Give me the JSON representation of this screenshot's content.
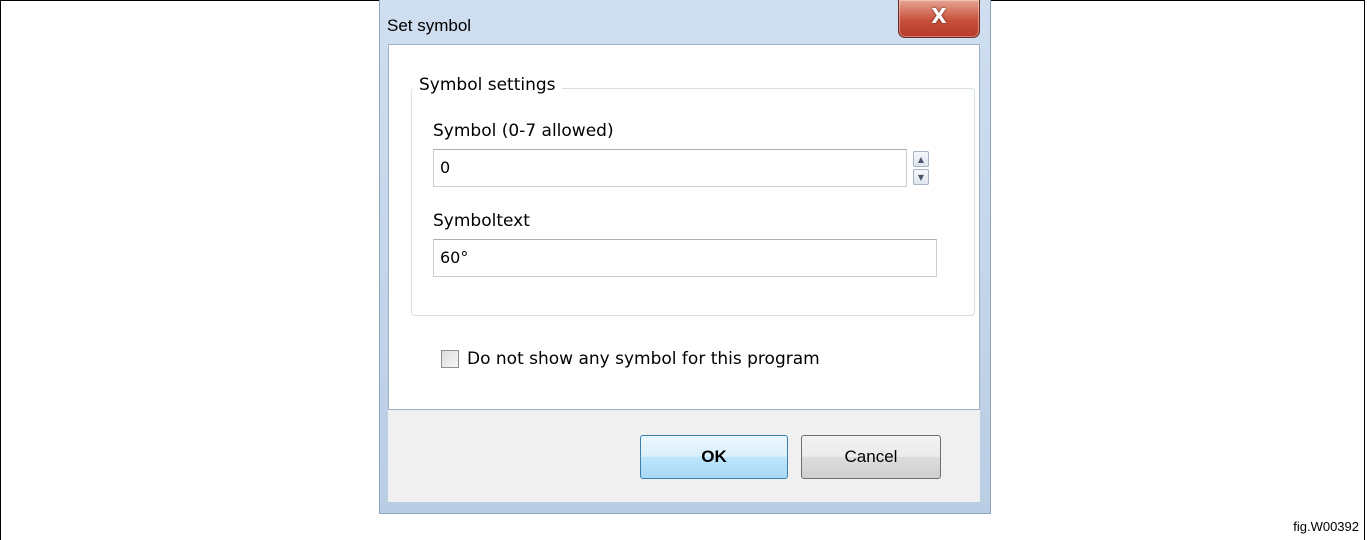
{
  "dialog": {
    "title": "Set symbol",
    "close_symbol": "X",
    "group_label": "Symbol settings",
    "symbol_label": "Symbol (0-7 allowed)",
    "symbol_value": "0",
    "symboltext_label": "Symboltext",
    "symboltext_value": "60°",
    "checkbox_label": "Do not show any symbol for this program",
    "checkbox_checked": false,
    "ok_label": "OK",
    "cancel_label": "Cancel"
  },
  "figure_label": "fig.W00392",
  "icons": {
    "close": "close-icon",
    "spin_up": "chevron-up-icon",
    "spin_down": "chevron-down-icon"
  },
  "colors": {
    "close_button": "#c7513a",
    "ok_accent": "#3c7fb1"
  }
}
